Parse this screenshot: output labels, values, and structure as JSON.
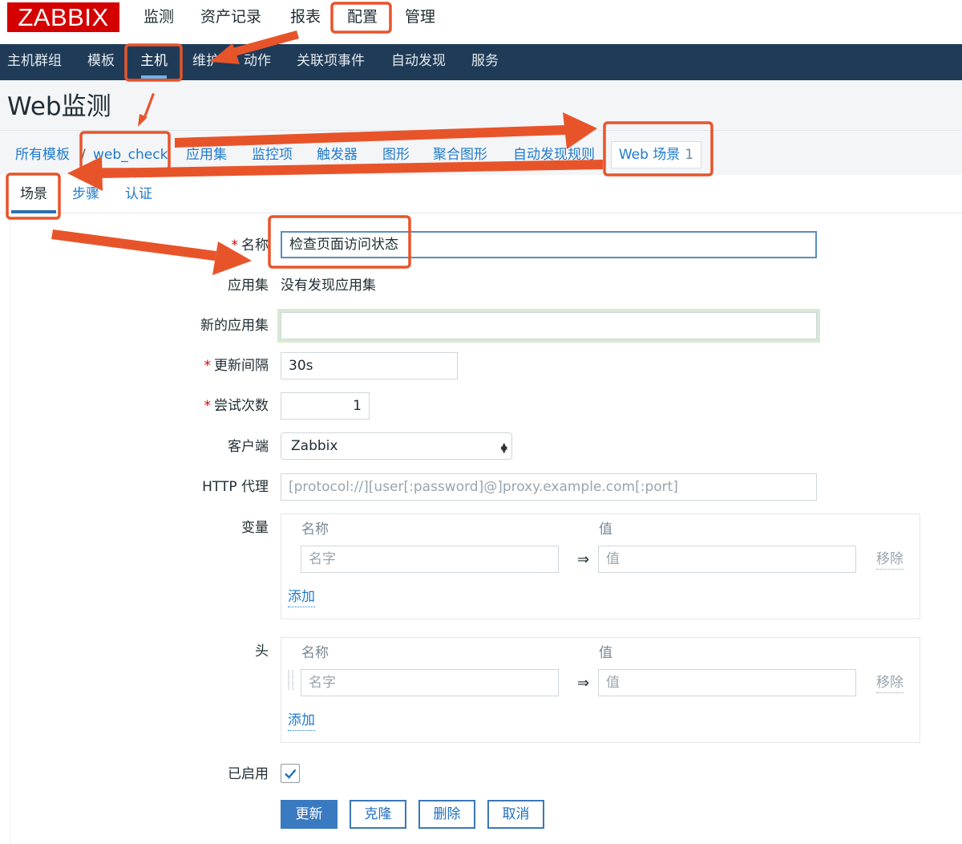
{
  "app": {
    "logo": "ZABBIX"
  },
  "top_menu": [
    "监测",
    "资产记录",
    "报表",
    "配置",
    "管理"
  ],
  "sub_menu": [
    "主机群组",
    "模板",
    "主机",
    "维护",
    "动作",
    "关联项事件",
    "自动发现",
    "服务"
  ],
  "page": {
    "title": "Web监测"
  },
  "breadcrumb": {
    "root": "所有模板",
    "separator": "/",
    "current": "web_check",
    "links": [
      "应用集",
      "监控项",
      "触发器",
      "图形",
      "聚合图形",
      "自动发现规则"
    ],
    "web_tab": {
      "label": "Web 场景",
      "count": "1"
    }
  },
  "tabs": [
    "场景",
    "步骤",
    "认证"
  ],
  "form": {
    "name": {
      "label": "名称",
      "value": "检查页面访问状态"
    },
    "app": {
      "label": "应用集",
      "value": "没有发现应用集"
    },
    "new_app": {
      "label": "新的应用集",
      "value": ""
    },
    "interval": {
      "label": "更新间隔",
      "value": "30s"
    },
    "retries": {
      "label": "尝试次数",
      "value": "1"
    },
    "client": {
      "label": "客户端",
      "value": "Zabbix"
    },
    "proxy": {
      "label": "HTTP 代理",
      "placeholder": "[protocol://][user[:password]@]proxy.example.com[:port]"
    },
    "variables": {
      "label": "变量",
      "col_name": "名称",
      "col_value": "值",
      "name_placeholder": "名字",
      "value_placeholder": "值",
      "arrow": "⇒",
      "remove": "移除",
      "add": "添加"
    },
    "headers": {
      "label": "头",
      "col_name": "名称",
      "col_value": "值",
      "name_placeholder": "名字",
      "value_placeholder": "值",
      "arrow": "⇒",
      "remove": "移除",
      "add": "添加"
    },
    "enabled": {
      "label": "已启用",
      "checked": true
    },
    "required_mark": "*"
  },
  "buttons": {
    "update": "更新",
    "clone": "克隆",
    "delete": "删除",
    "cancel": "取消"
  },
  "colors": {
    "brand": "#d40000",
    "nav": "#1f3b57",
    "link": "#1f7acb",
    "primary": "#3a7ac0",
    "annotation": "#e8542a"
  }
}
